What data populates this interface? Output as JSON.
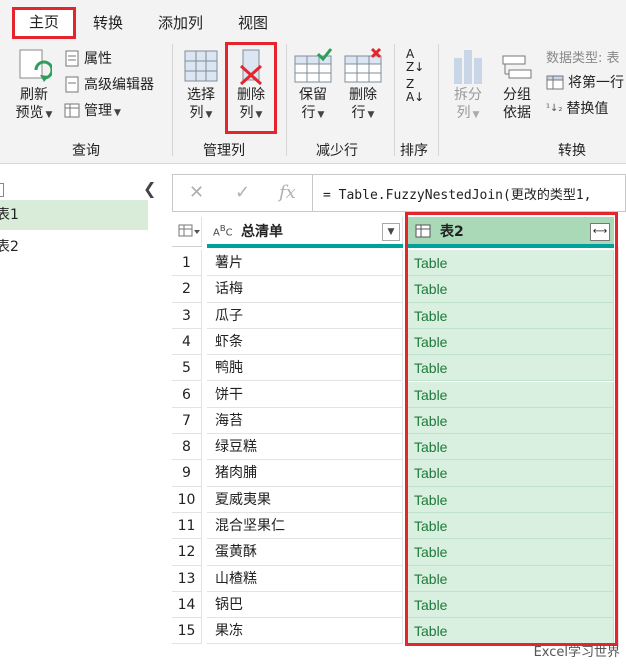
{
  "tabs": [
    "主页",
    "转换",
    "添加列",
    "视图"
  ],
  "ribbon": {
    "refresh": "刷新",
    "preview": "预览",
    "properties": "属性",
    "advanced_editor": "高级编辑器",
    "manage": "管理",
    "group_query": "查询",
    "choose_col_1": "选择",
    "choose_col_2": "列",
    "remove_col_1": "删除",
    "remove_col_2": "列",
    "group_manage_cols": "管理列",
    "keep_rows_1": "保留",
    "keep_rows_2": "行",
    "remove_rows_1": "删除",
    "remove_rows_2": "行",
    "group_reduce_rows": "减少行",
    "group_sort": "排序",
    "split_col_1": "拆分",
    "split_col_2": "列",
    "group_by_1": "分组",
    "group_by_2": "依据",
    "data_type": "数据类型: 表",
    "first_row": "将第一行",
    "replace_values": "替换值",
    "group_transform": "转换"
  },
  "queries": [
    "表1",
    "表2"
  ],
  "formula": "= Table.FuzzyNestedJoin(更改的类型1,",
  "columns": {
    "col1": "总清单",
    "col2": "表2"
  },
  "rows": [
    {
      "n": "1",
      "name": "薯片",
      "t": "Table"
    },
    {
      "n": "2",
      "name": "话梅",
      "t": "Table"
    },
    {
      "n": "3",
      "name": "瓜子",
      "t": "Table"
    },
    {
      "n": "4",
      "name": "虾条",
      "t": "Table"
    },
    {
      "n": "5",
      "name": "鸭肫",
      "t": "Table"
    },
    {
      "n": "6",
      "name": "饼干",
      "t": "Table"
    },
    {
      "n": "7",
      "name": "海苔",
      "t": "Table"
    },
    {
      "n": "8",
      "name": "绿豆糕",
      "t": "Table"
    },
    {
      "n": "9",
      "name": "猪肉脯",
      "t": "Table"
    },
    {
      "n": "10",
      "name": "夏威夷果",
      "t": "Table"
    },
    {
      "n": "11",
      "name": "混合坚果仁",
      "t": "Table"
    },
    {
      "n": "12",
      "name": "蛋黄酥",
      "t": "Table"
    },
    {
      "n": "13",
      "name": "山楂糕",
      "t": "Table"
    },
    {
      "n": "14",
      "name": "锅巴",
      "t": "Table"
    },
    {
      "n": "15",
      "name": "果冻",
      "t": "Table"
    }
  ],
  "watermark": "Excel学习世界",
  "colors": {
    "accent_red": "#e4252d",
    "table_green": "#d9efe0",
    "header_teal": "#00a19a"
  }
}
